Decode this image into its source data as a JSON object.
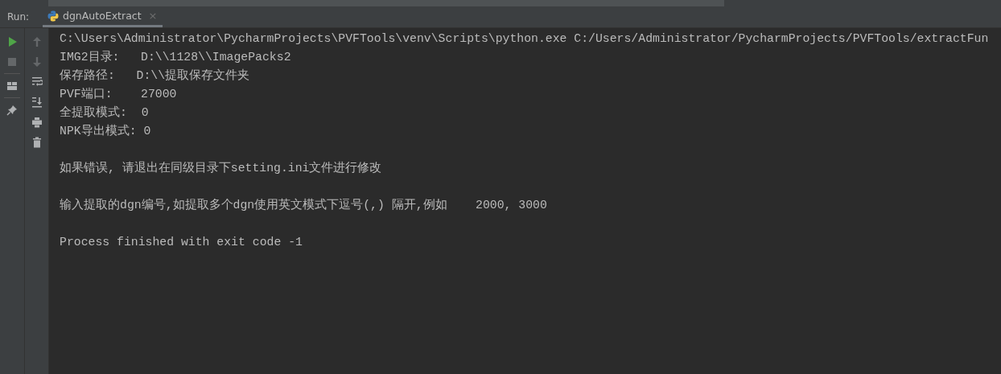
{
  "run_panel": {
    "label": "Run:",
    "tab": {
      "title": "dgnAutoExtract",
      "selected": true,
      "close": "×"
    }
  },
  "left_toolbar": [
    {
      "kind": "play",
      "disabled": false
    },
    {
      "kind": "stop",
      "disabled": true
    },
    {
      "kind": "sep"
    },
    {
      "kind": "layout",
      "disabled": false
    },
    {
      "kind": "sep"
    },
    {
      "kind": "pin",
      "disabled": false
    }
  ],
  "side_toolbar": [
    {
      "kind": "up",
      "disabled": true
    },
    {
      "kind": "down",
      "disabled": true
    },
    {
      "kind": "wrap",
      "disabled": false
    },
    {
      "kind": "scrollend",
      "disabled": false
    },
    {
      "kind": "print",
      "disabled": false
    },
    {
      "kind": "trash",
      "disabled": false
    }
  ],
  "console_blocks": [
    [
      "C:\\Users\\Administrator\\PycharmProjects\\PVFTools\\venv\\Scripts\\python.exe C:/Users/Administrator/PycharmProjects/PVFTools/extractFun",
      "IMG2目录:   D:\\\\1128\\\\ImagePacks2",
      "保存路径:   D:\\\\提取保存文件夹",
      "PVF端口:    27000",
      "全提取模式:  0",
      "NPK导出模式: 0"
    ],
    [
      "如果错误, 请退出在同级目录下setting.ini文件进行修改"
    ],
    [
      "输入提取的dgn编号,如提取多个dgn使用英文模式下逗号(,) 隔开,例如    2000, 3000"
    ],
    [
      "Process finished with exit code -1"
    ]
  ]
}
